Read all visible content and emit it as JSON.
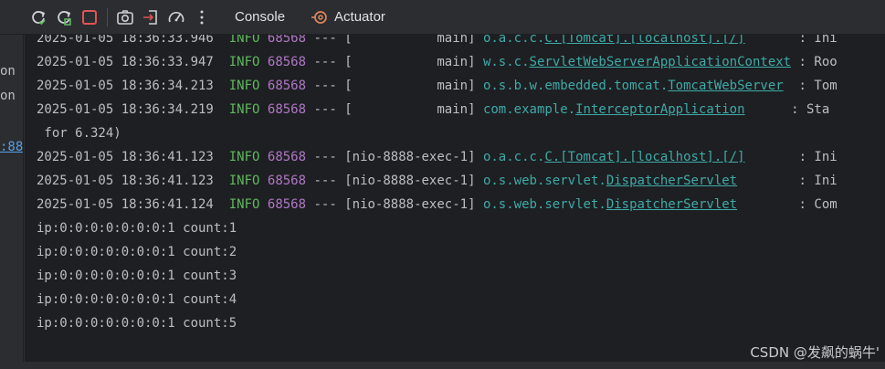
{
  "toolbar": {
    "buttons": [
      {
        "name": "rerun-icon"
      },
      {
        "name": "rerun-failed-icon"
      },
      {
        "name": "stop-icon"
      },
      {
        "name": "camera-icon"
      },
      {
        "name": "exit-icon"
      },
      {
        "name": "dashboard-icon"
      },
      {
        "name": "more-icon"
      }
    ],
    "tabs": [
      {
        "label": "Console"
      },
      {
        "label": "Actuator"
      }
    ]
  },
  "gutter": [
    "on",
    "on",
    ":88"
  ],
  "log": [
    {
      "ts": "2025-01-05 18:36:33.946",
      "level": "INFO",
      "pid": "68568",
      "sep": "---",
      "thread": "[           main]",
      "pkg": "o.a.c.c.",
      "cls": "C.[Tomcat].[localhost].[/]",
      "pad": "       ",
      "tail": ": Ini"
    },
    {
      "ts": "2025-01-05 18:36:33.947",
      "level": "INFO",
      "pid": "68568",
      "sep": "---",
      "thread": "[           main]",
      "pkg": "w.s.c.",
      "cls": "ServletWebServerApplicationContext",
      "pad": " ",
      "tail": ": Roo"
    },
    {
      "ts": "2025-01-05 18:36:34.213",
      "level": "INFO",
      "pid": "68568",
      "sep": "---",
      "thread": "[           main]",
      "pkg": "o.s.b.w.embedded.tomcat.",
      "cls": "TomcatWebServer",
      "pad": "  ",
      "tail": ": Tom"
    },
    {
      "ts": "2025-01-05 18:36:34.219",
      "level": "INFO",
      "pid": "68568",
      "sep": "---",
      "thread": "[           main]",
      "pkg": "com.example.",
      "cls": "InterceptorApplication",
      "pad": "      ",
      "tail": ": Sta"
    },
    {
      "text": " for 6.324)"
    },
    {
      "ts": "2025-01-05 18:36:41.123",
      "level": "INFO",
      "pid": "68568",
      "sep": "---",
      "thread": "[nio-8888-exec-1]",
      "pkg": "o.a.c.c.",
      "cls": "C.[Tomcat].[localhost].[/]",
      "pad": "       ",
      "tail": ": Ini"
    },
    {
      "ts": "2025-01-05 18:36:41.123",
      "level": "INFO",
      "pid": "68568",
      "sep": "---",
      "thread": "[nio-8888-exec-1]",
      "pkg": "o.s.web.servlet.",
      "cls": "DispatcherServlet",
      "pad": "        ",
      "tail": ": Ini"
    },
    {
      "ts": "2025-01-05 18:36:41.124",
      "level": "INFO",
      "pid": "68568",
      "sep": "---",
      "thread": "[nio-8888-exec-1]",
      "pkg": "o.s.web.servlet.",
      "cls": "DispatcherServlet",
      "pad": "        ",
      "tail": ": Com"
    },
    {
      "text": "ip:0:0:0:0:0:0:0:1 count:1"
    },
    {
      "text": "ip:0:0:0:0:0:0:0:1 count:2"
    },
    {
      "text": "ip:0:0:0:0:0:0:0:1 count:3"
    },
    {
      "text": "ip:0:0:0:0:0:0:0:1 count:4"
    },
    {
      "text": "ip:0:0:0:0:0:0:0:1 count:5"
    }
  ],
  "watermark": "CSDN @发飙的蜗牛'",
  "colors": {
    "level": "#5fb85f",
    "pid": "#b077c7",
    "logger": "#3eaaa8",
    "stop": "#e05555"
  }
}
